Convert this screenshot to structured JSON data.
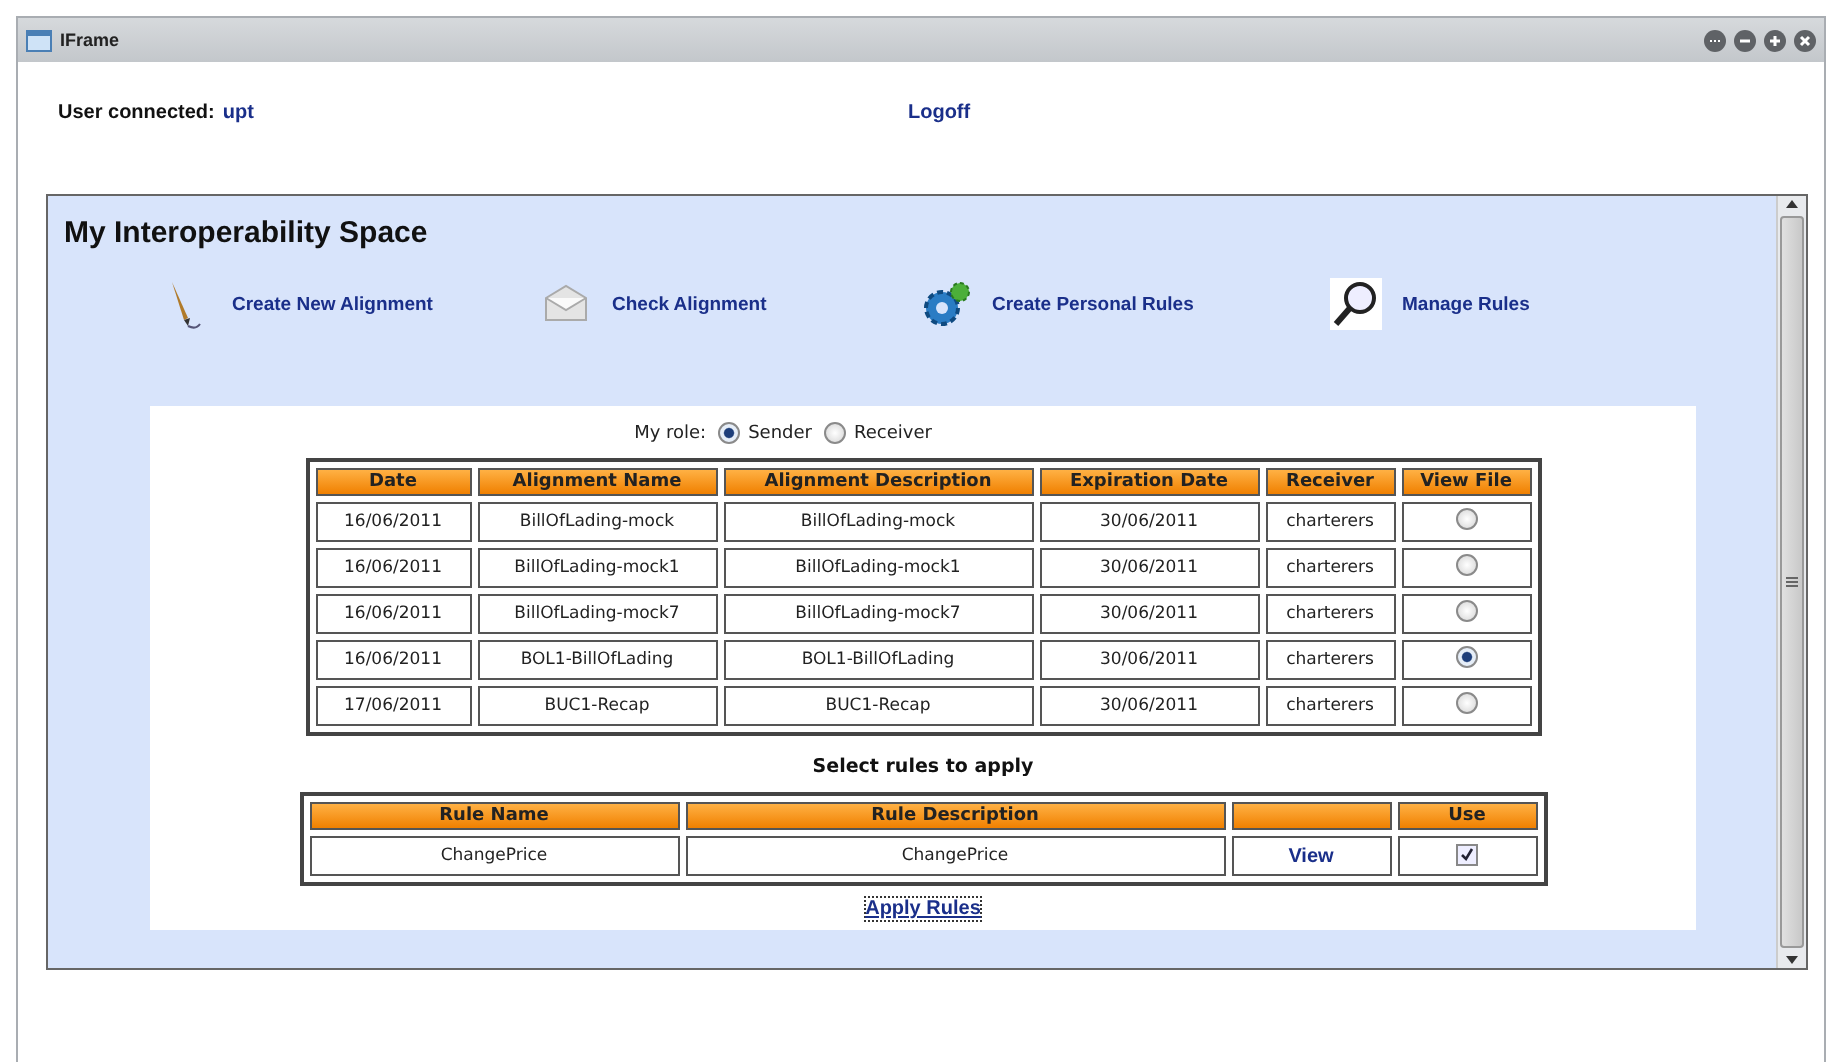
{
  "window": {
    "title": "IFrame"
  },
  "user": {
    "label": "User connected:",
    "name": "upt"
  },
  "logoff": "Logoff",
  "space": {
    "title": "My Interoperability Space",
    "actions": [
      {
        "kind": "pen",
        "label": "Create New Alignment"
      },
      {
        "kind": "envelope",
        "label": "Check Alignment"
      },
      {
        "kind": "gears",
        "label": "Create Personal Rules"
      },
      {
        "kind": "magnifier",
        "label": "Manage Rules"
      }
    ]
  },
  "role": {
    "label": "My role:",
    "options": [
      {
        "label": "Sender",
        "selected": true
      },
      {
        "label": "Receiver",
        "selected": false
      }
    ]
  },
  "alignments": {
    "columns": [
      "Date",
      "Alignment Name",
      "Alignment Description",
      "Expiration Date",
      "Receiver",
      "View File"
    ],
    "rows": [
      {
        "date": "16/06/2011",
        "name": "BillOfLading-mock",
        "description": "BillOfLading-mock",
        "expiration": "30/06/2011",
        "receiver": "charterers",
        "selected": false
      },
      {
        "date": "16/06/2011",
        "name": "BillOfLading-mock1",
        "description": "BillOfLading-mock1",
        "expiration": "30/06/2011",
        "receiver": "charterers",
        "selected": false
      },
      {
        "date": "16/06/2011",
        "name": "BillOfLading-mock7",
        "description": "BillOfLading-mock7",
        "expiration": "30/06/2011",
        "receiver": "charterers",
        "selected": false
      },
      {
        "date": "16/06/2011",
        "name": "BOL1-BillOfLading",
        "description": "BOL1-BillOfLading",
        "expiration": "30/06/2011",
        "receiver": "charterers",
        "selected": true
      },
      {
        "date": "17/06/2011",
        "name": "BUC1-Recap",
        "description": "BUC1-Recap",
        "expiration": "30/06/2011",
        "receiver": "charterers",
        "selected": false
      }
    ]
  },
  "rules": {
    "title": "Select rules to apply",
    "columns": [
      "Rule Name",
      "Rule Description",
      "Use"
    ],
    "rows": [
      {
        "name": "ChangePrice",
        "description": "ChangePrice",
        "link": "View",
        "checked": true
      }
    ]
  },
  "apply": "Apply Rules"
}
